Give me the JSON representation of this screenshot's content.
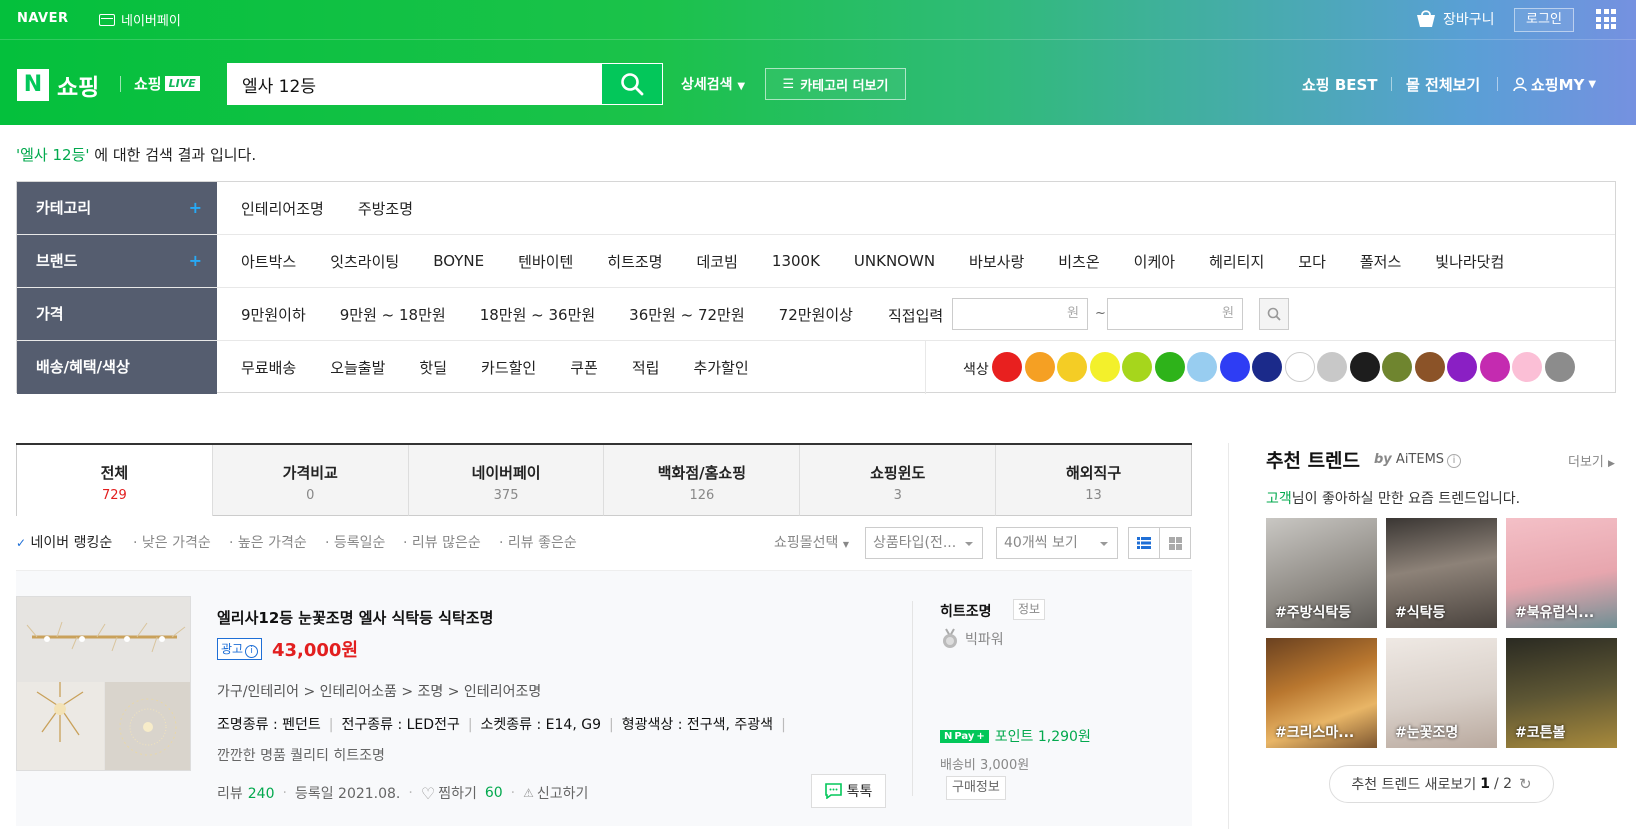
{
  "header": {
    "naver": "NAVER",
    "npay": "네이버페이",
    "cart": "장바구니",
    "login": "로그인",
    "brand_n": "N",
    "brand": "쇼핑",
    "shop_live": "쇼핑",
    "live_badge": "LIVE",
    "search_value": "엘사 12등",
    "detail_search": "상세검색",
    "category_more": "카테고리 더보기",
    "nav": [
      "쇼핑 BEST",
      "몰 전체보기",
      "쇼핑MY"
    ]
  },
  "result": {
    "keyword": "'엘사 12등'",
    "suffix": " 에 대한 검색 결과 입니다."
  },
  "filters": {
    "category": {
      "label": "카테고리",
      "options": [
        "인테리어조명",
        "주방조명"
      ]
    },
    "brand": {
      "label": "브랜드",
      "options": [
        "아트박스",
        "잇츠라이팅",
        "BOYNE",
        "텐바이텐",
        "히트조명",
        "데코빔",
        "1300K",
        "UNKNOWN",
        "바보사랑",
        "비츠온",
        "이케아",
        "헤리티지",
        "모다",
        "폴저스",
        "빛나라닷컴"
      ]
    },
    "price": {
      "label": "가격",
      "options": [
        "9만원이하",
        "9만원 ~ 18만원",
        "18만원 ~ 36만원",
        "36만원 ~ 72만원",
        "72만원이상"
      ],
      "direct": "직접입력",
      "unit": "원",
      "tilde": "~"
    },
    "benefit": {
      "label": "배송/혜택/색상",
      "options": [
        "무료배송",
        "오늘출발",
        "핫딜",
        "카드할인",
        "쿠폰",
        "적립",
        "추가할인"
      ]
    },
    "color_label": "색상",
    "colors": [
      "#e8201f",
      "#f5a023",
      "#f4cd25",
      "#f3f02b",
      "#a6d61c",
      "#2eb31a",
      "#98cdf0",
      "#2e3df4",
      "#1b2a8a",
      "#ffffff",
      "#c8c8c8",
      "#1d1d1d",
      "#6f852f",
      "#8b5328",
      "#8a1fc4",
      "#c42bb0",
      "#fbbfd6",
      "#8c8c8c"
    ]
  },
  "tabs": [
    {
      "label": "전체",
      "count": "729"
    },
    {
      "label": "가격비교",
      "count": "0"
    },
    {
      "label": "네이버페이",
      "count": "375"
    },
    {
      "label": "백화점/홈쇼핑",
      "count": "126"
    },
    {
      "label": "쇼핑윈도",
      "count": "3"
    },
    {
      "label": "해외직구",
      "count": "13"
    }
  ],
  "sort": {
    "options": [
      "네이버 랭킹순",
      "낮은 가격순",
      "높은 가격순",
      "등록일순",
      "리뷰 많은순",
      "리뷰 좋은순"
    ],
    "mall_select": "쇼핑몰선택",
    "product_type": "상품타입(전...",
    "view_count": "40개씩 보기"
  },
  "product": {
    "title": "엘리사12등 눈꽃조명 엘사 식탁등 식탁조명",
    "ad": "광고",
    "price": "43,000원",
    "path": "가구/인테리어 > 인테리어소품 > 조명 > 인테리어조명",
    "specs": [
      "조명종류 : 펜던트",
      "전구종류 : LED전구",
      "소켓종류 : E14, G9",
      "형광색상 : 전구색, 주광색"
    ],
    "desc": "깐깐한 명품 퀄리티 히트조명",
    "review_label": "리뷰",
    "review_count": "240",
    "reg_date": "등록일 2021.08.",
    "zzim_label": "찜하기",
    "zzim_count": "60",
    "report": "신고하기",
    "talk": "톡톡",
    "mall": "히트조명",
    "mall_info": "정보",
    "grade": "빅파워",
    "point": "포인트 1,290원",
    "npay_text": "Pay",
    "shipping": "배송비 3,000원",
    "buy_info": "구매정보"
  },
  "trend": {
    "title": "추천 트렌드",
    "by": "by",
    "aitems": "AiTEMS",
    "info": "i",
    "more": "더보기",
    "sub_user": "고객",
    "sub_rest": "님이 좋아하실 만한 요즘 트렌드입니다.",
    "cards": [
      {
        "tag": "#주방식탁등",
        "bg": "linear-gradient(160deg,#c9c7c3,#8e8a84 60%,#5d5a56)"
      },
      {
        "tag": "#식탁등",
        "bg": "linear-gradient(170deg,#3a3633,#8d8278 45%,#4a433e)"
      },
      {
        "tag": "#북유럽식...",
        "bg": "linear-gradient(170deg,#f4c0c7,#e7a6ae 55%,#6f8f94)"
      },
      {
        "tag": "#크리스마...",
        "bg": "linear-gradient(160deg,#6a4120,#b9772f 40%,#e8b566 70%,#7d5630)"
      },
      {
        "tag": "#눈꽃조명",
        "bg": "linear-gradient(170deg,#efe9e4,#d8cfc8 55%,#b9a99e)"
      },
      {
        "tag": "#코튼볼",
        "bg": "linear-gradient(170deg,#2a2a22,#5d5634 50%,#a88a3c)"
      }
    ],
    "refresh_label": "추천 트렌드 새로보기",
    "page": "1",
    "total": "/ 2"
  }
}
